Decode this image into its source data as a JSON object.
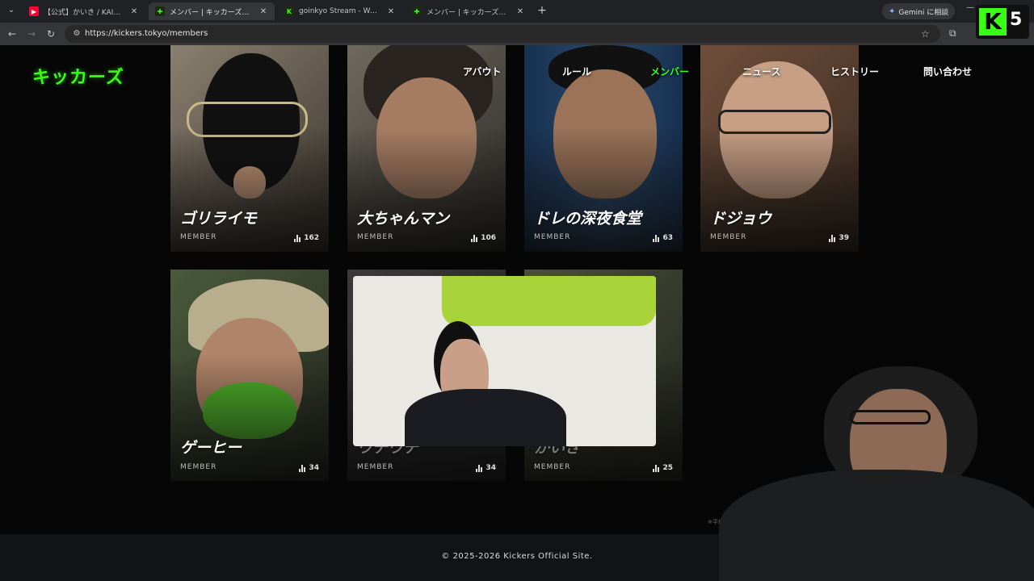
{
  "browser": {
    "tabs": [
      {
        "title": "【公式】かいき / KAIKI【キッカーズ 三",
        "favicon": "youtube",
        "active": false
      },
      {
        "title": "メンバー | キッカーズ公式サイト",
        "favicon": "kickers",
        "active": true
      },
      {
        "title": "goinkyo Stream - Watch Live o",
        "favicon": "kickers-k",
        "active": false
      },
      {
        "title": "メンバー | キッカーズ公式サイト",
        "favicon": "kickers",
        "active": false
      }
    ],
    "url": "https://kickers.tokyo/members",
    "gemini_label": "Gemini に相談",
    "overlay_badge": {
      "letter": "K",
      "number": "5"
    }
  },
  "site": {
    "logo": "キッカーズ",
    "nav": [
      {
        "label": "アバウト",
        "active": false
      },
      {
        "label": "ルール",
        "active": false
      },
      {
        "label": "メンバー",
        "active": true
      },
      {
        "label": "ニュース",
        "active": false
      },
      {
        "label": "ヒストリー",
        "active": false
      },
      {
        "label": "問い合わせ",
        "active": false
      }
    ],
    "members": [
      {
        "name": "ゴリライモ",
        "role": "MEMBER",
        "count": "162"
      },
      {
        "name": "大ちゃんマン",
        "role": "MEMBER",
        "count": "106"
      },
      {
        "name": "ドレの深夜食堂",
        "role": "MEMBER",
        "count": "63"
      },
      {
        "name": "ドジョウ",
        "role": "MEMBER",
        "count": "39"
      },
      {
        "name": "ゲーヒー",
        "role": "MEMBER",
        "count": "34"
      },
      {
        "name": "ウチウチ",
        "role": "MEMBER",
        "count": "34"
      },
      {
        "name": "かいき",
        "role": "MEMBER",
        "count": "25"
      }
    ],
    "note": "※平均同接",
    "footer": "© 2025-2026 Kickers Official Site."
  },
  "colors": {
    "accent": "#39ff14",
    "page_bg": "#060606",
    "footer_bg": "#121314"
  }
}
